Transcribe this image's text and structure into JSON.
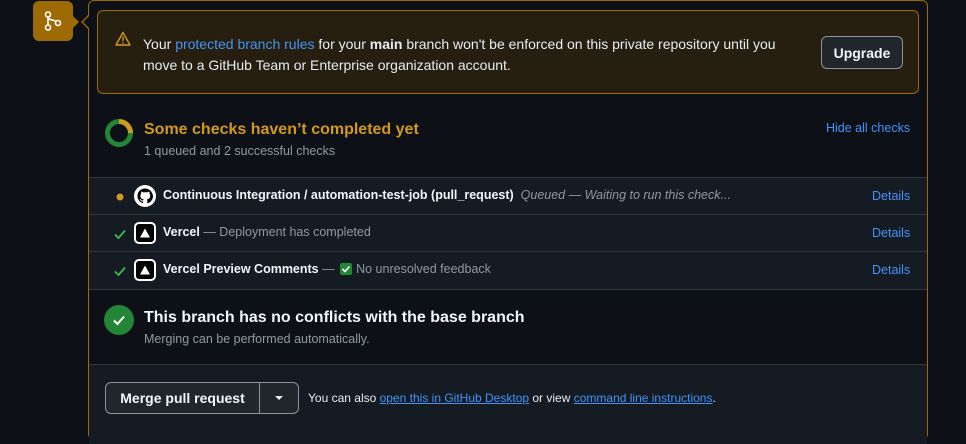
{
  "banner": {
    "prefix": "Your ",
    "link": "protected branch rules",
    "middle": " for your ",
    "branch": "main",
    "suffix": " branch won't be enforced on this private repository until you move to a GitHub Team or Enterprise organization account.",
    "upgrade_label": "Upgrade"
  },
  "checks": {
    "title": "Some checks haven’t completed yet",
    "subtitle": "1 queued and 2 successful checks",
    "hide_label": "Hide all checks",
    "items": [
      {
        "status": "queued",
        "name": "Continuous Integration / automation-test-job (pull_request)",
        "description": "Queued — Waiting to run this check...",
        "details": "Details",
        "icon": "github-icon"
      },
      {
        "status": "success",
        "name": "Vercel",
        "description": "— Deployment has completed",
        "details": "Details",
        "icon": "vercel-icon"
      },
      {
        "status": "success",
        "name": "Vercel Preview Comments",
        "desc_prefix": "—",
        "description": "No unresolved feedback",
        "details": "Details",
        "icon": "vercel-icon"
      }
    ]
  },
  "conflicts": {
    "title": "This branch has no conflicts with the base branch",
    "subtitle": "Merging can be performed automatically."
  },
  "merge": {
    "button_label": "Merge pull request",
    "hint_prefix": "You can also ",
    "desktop_link": "open this in GitHub Desktop",
    "hint_middle": " or view ",
    "cli_link": "command line instructions",
    "hint_suffix": "."
  },
  "colors": {
    "accent_warning": "#9e6a03",
    "pending": "#d29922",
    "success": "#238636",
    "link": "#4493f8"
  }
}
